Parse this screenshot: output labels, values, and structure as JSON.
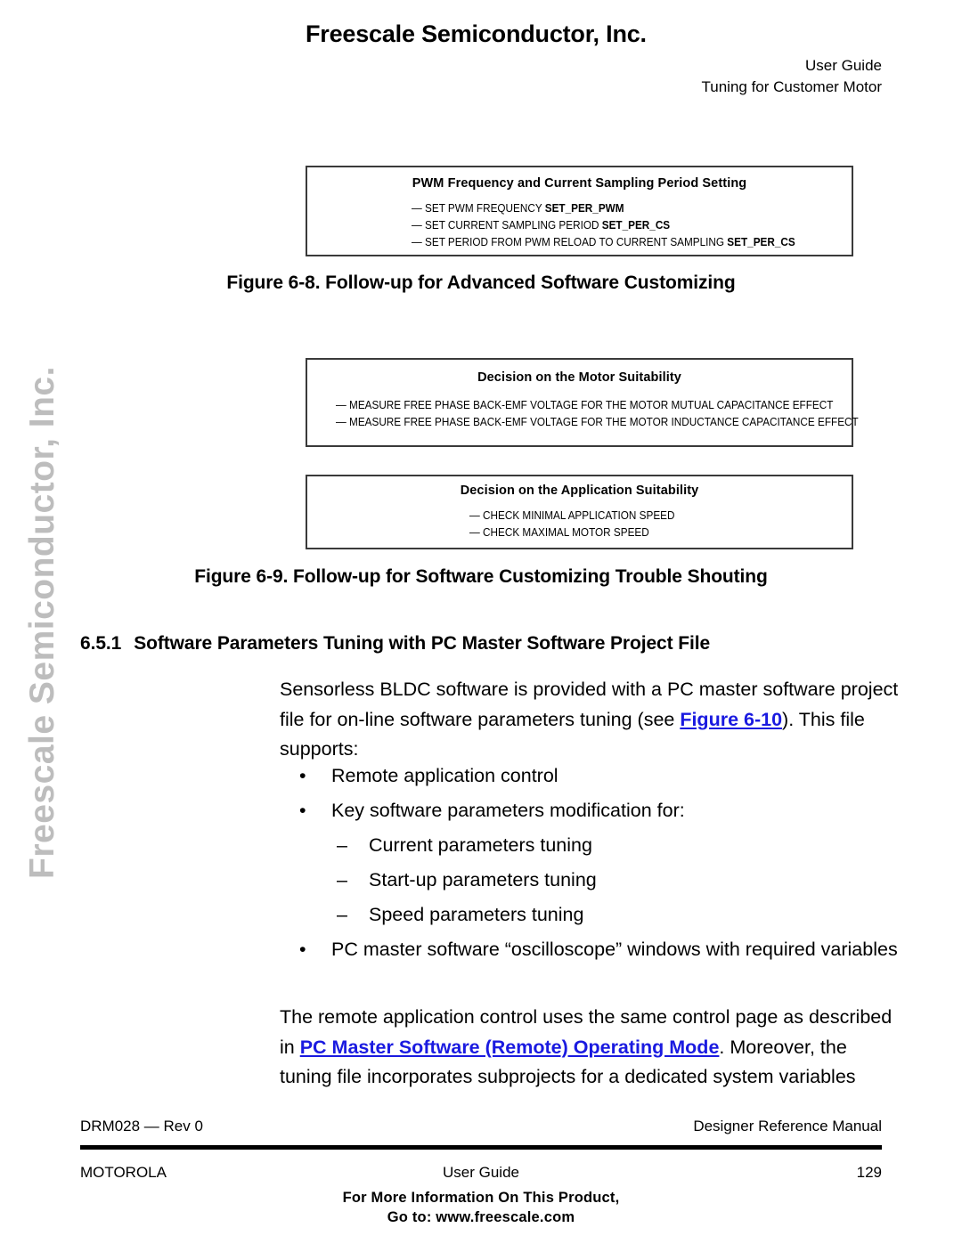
{
  "watermark": {
    "text": "Freescale Semiconductor, Inc.",
    "color": "#bdbdbd"
  },
  "header": {
    "title": "Freescale Semiconductor, Inc.",
    "line1": "User Guide",
    "line2": "Tuning for Customer Motor"
  },
  "boxes": [
    {
      "title": "PWM Frequency and Current Sampling Period Setting",
      "items": [
        {
          "prefix": "— ",
          "text": "SET PWM FREQUENCY ",
          "bold": "SET_PER_PWM"
        },
        {
          "prefix": "— ",
          "text": "SET CURRENT SAMPLING PERIOD ",
          "bold": "SET_PER_CS"
        },
        {
          "prefix": "— ",
          "text": "SET PERIOD FROM PWM RELOAD TO CURRENT SAMPLING ",
          "bold": "SET_PER_CS"
        }
      ]
    },
    {
      "title": "Decision on the Motor Suitability",
      "items": [
        {
          "prefix": "— ",
          "text": "MEASURE FREE PHASE BACK-EMF VOLTAGE FOR THE MOTOR MUTUAL CAPACITANCE EFFECT",
          "bold": ""
        },
        {
          "prefix": "— ",
          "text": "MEASURE FREE PHASE BACK-EMF VOLTAGE FOR THE MOTOR INDUCTANCE CAPACITANCE EFFECT",
          "bold": ""
        }
      ]
    },
    {
      "title": "Decision on the Application Suitability",
      "items": [
        {
          "prefix": "— ",
          "text": "CHECK MINIMAL APPLICATION SPEED",
          "bold": ""
        },
        {
          "prefix": "— ",
          "text": "CHECK MAXIMAL MOTOR SPEED",
          "bold": ""
        }
      ]
    }
  ],
  "captions": {
    "figure_6_8": "Figure 6-8. Follow-up for Advanced Software Customizing",
    "figure_6_9": "Figure 6-9. Follow-up for Software Customizing Trouble Shouting"
  },
  "section": {
    "number": "6.5.1",
    "title": "Software Parameters Tuning with PC Master Software Project File"
  },
  "paragraph_1": {
    "part_1": "Sensorless BLDC software is provided with a PC master software project file for on-line software parameters tuning (see ",
    "link": "Figure 6-10",
    "part_2": "). This file supports:"
  },
  "bullets": [
    {
      "level": 1,
      "mark": "•",
      "text": "Remote application control"
    },
    {
      "level": 1,
      "mark": "•",
      "text": "Key software parameters modification for:"
    },
    {
      "level": 2,
      "mark": "–",
      "text": "Current parameters tuning"
    },
    {
      "level": 2,
      "mark": "–",
      "text": "Start-up parameters tuning"
    },
    {
      "level": 2,
      "mark": "–",
      "text": "Speed parameters tuning"
    },
    {
      "level": 1,
      "mark": "•",
      "text": "PC master software “oscilloscope” windows with required variables"
    }
  ],
  "paragraph_2": {
    "part_1": "The remote application control uses the same control page as described in ",
    "link": "PC Master Software (Remote) Operating Mode",
    "part_2": ". Moreover, the tuning file incorporates subprojects for a dedicated system variables"
  },
  "footer": {
    "doc_id": "DRM028 — Rev 0",
    "doc_type": "Designer Reference Manual",
    "company": "MOTOROLA",
    "guide": "User Guide",
    "page_number": "129",
    "promo_line1": "For More Information On This Product,",
    "promo_line2": "Go to: www.freescale.com"
  },
  "colors": {
    "link": "#1a1ae0",
    "watermark": "#bdbdbd",
    "box_border": "#3a3a3a",
    "text": "#000000"
  }
}
